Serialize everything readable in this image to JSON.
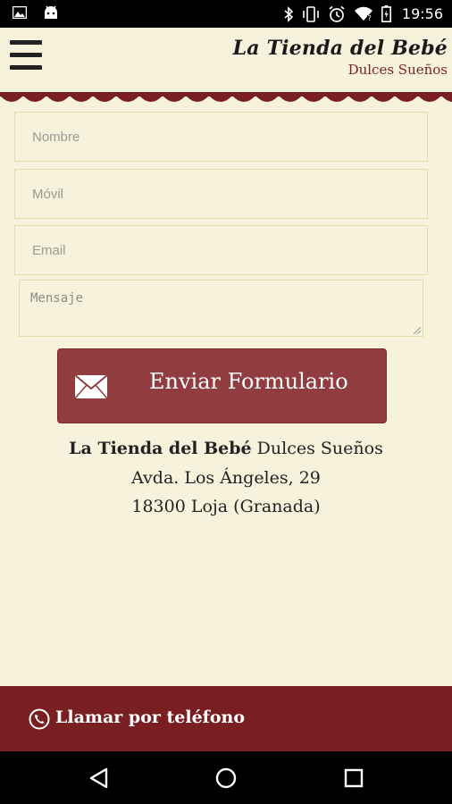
{
  "status_bar": {
    "time": "19:56",
    "icons": [
      "image-icon",
      "android-icon",
      "bluetooth-icon",
      "vibrate-icon",
      "alarm-icon",
      "wifi-icon",
      "battery-icon"
    ]
  },
  "header": {
    "brand_title": "La Tienda del Bebé",
    "brand_subtitle": "Dulces Sueños",
    "menu_icon": "hamburger-menu-icon"
  },
  "form": {
    "name_placeholder": "Nombre",
    "mobile_placeholder": "Móvil",
    "email_placeholder": "Email",
    "message_placeholder": "Mensaje",
    "submit_label": "Enviar Formulario",
    "submit_icon": "envelope-icon"
  },
  "address": {
    "store_name_bold": "La Tienda del Bebé",
    "store_name_rest": " Dulces Sueños",
    "street": "Avda. Los Ángeles, 29",
    "city": "18300 Loja (Granada)"
  },
  "call_bar": {
    "label": "Llamar por teléfono",
    "icon": "phone-icon"
  },
  "navigation": {
    "buttons": [
      "back-icon",
      "home-icon",
      "recents-icon"
    ]
  },
  "colors": {
    "background": "#f7f2dc",
    "accent": "#913c3e",
    "dark_accent": "#791f22"
  }
}
